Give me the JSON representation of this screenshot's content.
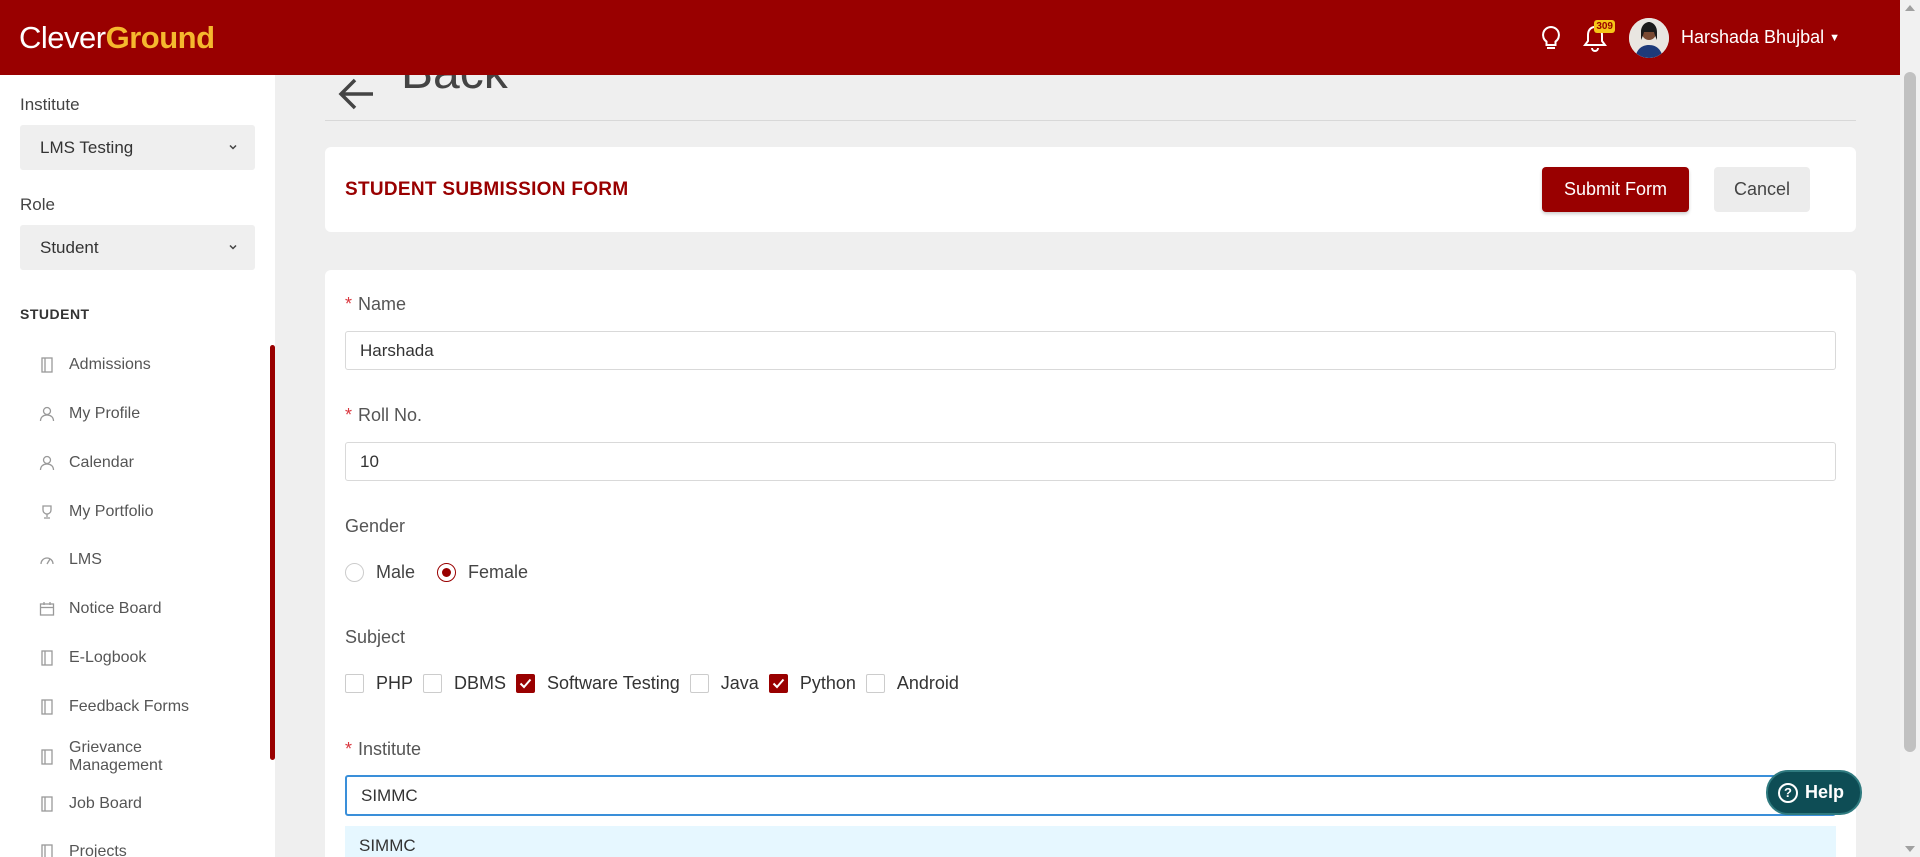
{
  "brand": {
    "part1": "Clever",
    "part2": "Ground"
  },
  "topbar": {
    "notification_count": "309",
    "user_name": "Harshada Bhujbal"
  },
  "sidebar": {
    "institute_label": "Institute",
    "institute_value": "LMS Testing",
    "role_label": "Role",
    "role_value": "Student",
    "section_title": "STUDENT",
    "items": [
      {
        "label": "Admissions",
        "icon": "book-icon"
      },
      {
        "label": "My Profile",
        "icon": "user-icon"
      },
      {
        "label": "Calendar",
        "icon": "user-icon"
      },
      {
        "label": "My Portfolio",
        "icon": "trophy-icon"
      },
      {
        "label": "LMS",
        "icon": "gauge-icon"
      },
      {
        "label": "Notice Board",
        "icon": "calendar-icon"
      },
      {
        "label": "E-Logbook",
        "icon": "book-icon"
      },
      {
        "label": "Feedback Forms",
        "icon": "book-icon"
      },
      {
        "label": "Grievance",
        "label2": "Management",
        "icon": "book-icon"
      },
      {
        "label": "Job Board",
        "icon": "book-icon"
      },
      {
        "label": "Projects",
        "icon": "book-icon"
      }
    ]
  },
  "main": {
    "back_label": "Back",
    "form_title": "STUDENT SUBMISSION FORM",
    "submit_label": "Submit Form",
    "cancel_label": "Cancel",
    "name_label": "Name",
    "name_value": "Harshada",
    "roll_label": "Roll No.",
    "roll_value": "10",
    "gender_label": "Gender",
    "gender_options": [
      "Male",
      "Female"
    ],
    "gender_selected": "Female",
    "subject_label": "Subject",
    "subjects": [
      {
        "label": "PHP",
        "checked": false
      },
      {
        "label": "DBMS",
        "checked": false
      },
      {
        "label": "Software Testing",
        "checked": true
      },
      {
        "label": "Java",
        "checked": false
      },
      {
        "label": "Python",
        "checked": true
      },
      {
        "label": "Android",
        "checked": false
      }
    ],
    "institute_label": "Institute",
    "institute_value": "SIMMC",
    "institute_option": "SIMMC"
  },
  "help_label": "Help",
  "colors": {
    "brand": "#990000",
    "brand_accent": "#f5b82e",
    "focus": "#3a8fd9",
    "help": "#0e4d55"
  }
}
